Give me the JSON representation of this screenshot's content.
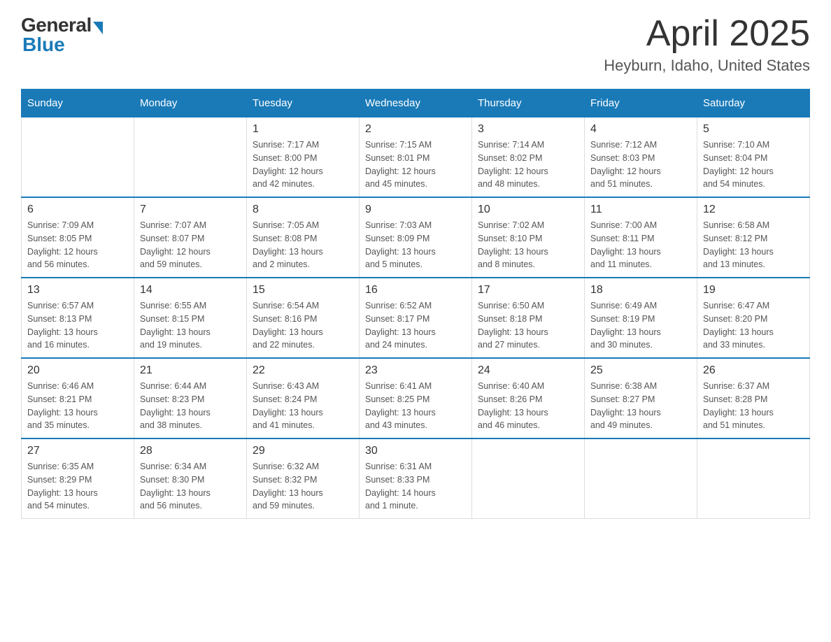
{
  "logo": {
    "general": "General",
    "blue": "Blue"
  },
  "header": {
    "title": "April 2025",
    "subtitle": "Heyburn, Idaho, United States"
  },
  "days_of_week": [
    "Sunday",
    "Monday",
    "Tuesday",
    "Wednesday",
    "Thursday",
    "Friday",
    "Saturday"
  ],
  "weeks": [
    [
      {
        "day": "",
        "info": ""
      },
      {
        "day": "",
        "info": ""
      },
      {
        "day": "1",
        "info": "Sunrise: 7:17 AM\nSunset: 8:00 PM\nDaylight: 12 hours\nand 42 minutes."
      },
      {
        "day": "2",
        "info": "Sunrise: 7:15 AM\nSunset: 8:01 PM\nDaylight: 12 hours\nand 45 minutes."
      },
      {
        "day": "3",
        "info": "Sunrise: 7:14 AM\nSunset: 8:02 PM\nDaylight: 12 hours\nand 48 minutes."
      },
      {
        "day": "4",
        "info": "Sunrise: 7:12 AM\nSunset: 8:03 PM\nDaylight: 12 hours\nand 51 minutes."
      },
      {
        "day": "5",
        "info": "Sunrise: 7:10 AM\nSunset: 8:04 PM\nDaylight: 12 hours\nand 54 minutes."
      }
    ],
    [
      {
        "day": "6",
        "info": "Sunrise: 7:09 AM\nSunset: 8:05 PM\nDaylight: 12 hours\nand 56 minutes."
      },
      {
        "day": "7",
        "info": "Sunrise: 7:07 AM\nSunset: 8:07 PM\nDaylight: 12 hours\nand 59 minutes."
      },
      {
        "day": "8",
        "info": "Sunrise: 7:05 AM\nSunset: 8:08 PM\nDaylight: 13 hours\nand 2 minutes."
      },
      {
        "day": "9",
        "info": "Sunrise: 7:03 AM\nSunset: 8:09 PM\nDaylight: 13 hours\nand 5 minutes."
      },
      {
        "day": "10",
        "info": "Sunrise: 7:02 AM\nSunset: 8:10 PM\nDaylight: 13 hours\nand 8 minutes."
      },
      {
        "day": "11",
        "info": "Sunrise: 7:00 AM\nSunset: 8:11 PM\nDaylight: 13 hours\nand 11 minutes."
      },
      {
        "day": "12",
        "info": "Sunrise: 6:58 AM\nSunset: 8:12 PM\nDaylight: 13 hours\nand 13 minutes."
      }
    ],
    [
      {
        "day": "13",
        "info": "Sunrise: 6:57 AM\nSunset: 8:13 PM\nDaylight: 13 hours\nand 16 minutes."
      },
      {
        "day": "14",
        "info": "Sunrise: 6:55 AM\nSunset: 8:15 PM\nDaylight: 13 hours\nand 19 minutes."
      },
      {
        "day": "15",
        "info": "Sunrise: 6:54 AM\nSunset: 8:16 PM\nDaylight: 13 hours\nand 22 minutes."
      },
      {
        "day": "16",
        "info": "Sunrise: 6:52 AM\nSunset: 8:17 PM\nDaylight: 13 hours\nand 24 minutes."
      },
      {
        "day": "17",
        "info": "Sunrise: 6:50 AM\nSunset: 8:18 PM\nDaylight: 13 hours\nand 27 minutes."
      },
      {
        "day": "18",
        "info": "Sunrise: 6:49 AM\nSunset: 8:19 PM\nDaylight: 13 hours\nand 30 minutes."
      },
      {
        "day": "19",
        "info": "Sunrise: 6:47 AM\nSunset: 8:20 PM\nDaylight: 13 hours\nand 33 minutes."
      }
    ],
    [
      {
        "day": "20",
        "info": "Sunrise: 6:46 AM\nSunset: 8:21 PM\nDaylight: 13 hours\nand 35 minutes."
      },
      {
        "day": "21",
        "info": "Sunrise: 6:44 AM\nSunset: 8:23 PM\nDaylight: 13 hours\nand 38 minutes."
      },
      {
        "day": "22",
        "info": "Sunrise: 6:43 AM\nSunset: 8:24 PM\nDaylight: 13 hours\nand 41 minutes."
      },
      {
        "day": "23",
        "info": "Sunrise: 6:41 AM\nSunset: 8:25 PM\nDaylight: 13 hours\nand 43 minutes."
      },
      {
        "day": "24",
        "info": "Sunrise: 6:40 AM\nSunset: 8:26 PM\nDaylight: 13 hours\nand 46 minutes."
      },
      {
        "day": "25",
        "info": "Sunrise: 6:38 AM\nSunset: 8:27 PM\nDaylight: 13 hours\nand 49 minutes."
      },
      {
        "day": "26",
        "info": "Sunrise: 6:37 AM\nSunset: 8:28 PM\nDaylight: 13 hours\nand 51 minutes."
      }
    ],
    [
      {
        "day": "27",
        "info": "Sunrise: 6:35 AM\nSunset: 8:29 PM\nDaylight: 13 hours\nand 54 minutes."
      },
      {
        "day": "28",
        "info": "Sunrise: 6:34 AM\nSunset: 8:30 PM\nDaylight: 13 hours\nand 56 minutes."
      },
      {
        "day": "29",
        "info": "Sunrise: 6:32 AM\nSunset: 8:32 PM\nDaylight: 13 hours\nand 59 minutes."
      },
      {
        "day": "30",
        "info": "Sunrise: 6:31 AM\nSunset: 8:33 PM\nDaylight: 14 hours\nand 1 minute."
      },
      {
        "day": "",
        "info": ""
      },
      {
        "day": "",
        "info": ""
      },
      {
        "day": "",
        "info": ""
      }
    ]
  ]
}
